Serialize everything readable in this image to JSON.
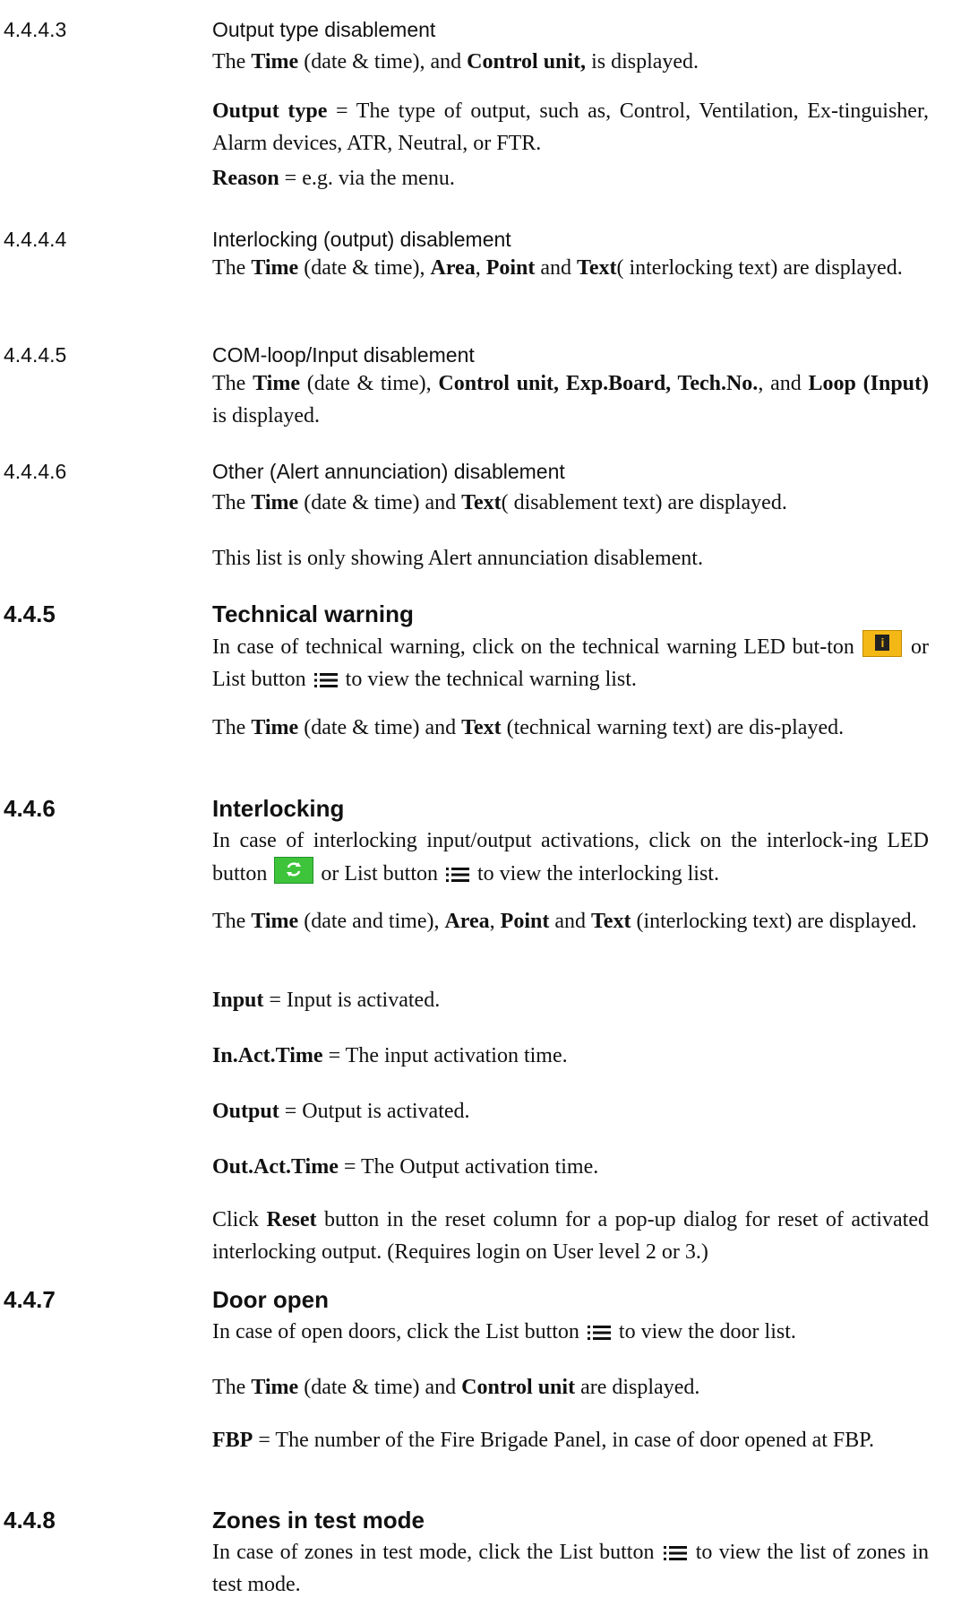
{
  "s4443": {
    "num": "4.4.4.3",
    "title": "Output type disablement",
    "p1": {
      "a": "The ",
      "b1": "Time",
      "c": " (date & time), and ",
      "b2": "Control unit,",
      "d": " is displayed."
    },
    "p2": {
      "b1": "Output type",
      "c": " = The type of output, such as, Control, Ventilation, Ex-tinguisher, Alarm devices, ATR, Neutral, or FTR."
    },
    "p3": {
      "b1": "Reason",
      "c": " = e.g. via the menu."
    }
  },
  "s4444": {
    "num": "4.4.4.4",
    "title": "Interlocking (output) disablement",
    "p1": {
      "a": "The ",
      "b1": "Time",
      "c": " (date & time), ",
      "b2": "Area",
      "d": ", ",
      "b3": "Point",
      "e": " and ",
      "b4": "Text",
      "f": "( interlocking text) are displayed."
    }
  },
  "s4445": {
    "num": "4.4.4.5",
    "title": "COM-loop/Input disablement",
    "p1": {
      "a": "The ",
      "b1": "Time",
      "c": " (date & time), ",
      "b2": "Control unit, Exp.Board, Tech.No.",
      "d": ", and ",
      "b3": "Loop (Input)",
      "e": " is displayed."
    }
  },
  "s4446": {
    "num": "4.4.4.6",
    "title": "Other (Alert annunciation) disablement",
    "p1": {
      "a": "The ",
      "b1": "Time",
      "c": " (date & time) and ",
      "b2": "Text",
      "d": "( disablement text) are displayed."
    },
    "p2": "This list is only showing Alert annunciation disablement."
  },
  "s445": {
    "num": "4.4.5",
    "title": "Technical warning",
    "p1": {
      "a": "In case of technical warning, click on the technical warning LED but-ton ",
      "b": " or List button ",
      "c": " to view the technical warning list."
    },
    "p2": {
      "a": "The ",
      "b1": "Time",
      "c": " (date & time) and ",
      "b2": "Text",
      "d": " (technical warning text) are dis-played."
    }
  },
  "s446": {
    "num": "4.4.6",
    "title": "Interlocking",
    "p1": {
      "a": "In case of interlocking input/output activations, click on the interlock-ing LED button ",
      "b": " or List button ",
      "c": " to view the interlocking list."
    },
    "p2": {
      "a": "The ",
      "b1": "Time",
      "c": " (date and time), ",
      "b2": "Area",
      "d": ", ",
      "b3": "Point",
      "e": " and ",
      "b4": "Text",
      "f": " (interlocking text) are displayed."
    },
    "p3": {
      "b": "Input",
      "c": " = Input is activated."
    },
    "p4": {
      "b": "In.Act.Time",
      "c": " = The input activation time."
    },
    "p5": {
      "b": "Output",
      "c": " = Output is activated."
    },
    "p6": {
      "b": "Out.Act.Time",
      "c": " = The Output activation time."
    },
    "p7": {
      "a": "Click ",
      "b": "Reset",
      "c": " button in the reset column for a pop-up dialog for reset of activated interlocking output. (Requires login on User level 2 or 3.)"
    }
  },
  "s447": {
    "num": "4.4.7",
    "title": "Door open",
    "p1": {
      "a": "In case of open doors, click the List button ",
      "b": " to view the door list."
    },
    "p2": {
      "a": "The ",
      "b1": "Time",
      "c": " (date & time) and ",
      "b2": "Control unit",
      "d": " are displayed."
    },
    "p3": {
      "b": "FBP",
      "c": " = The number of the Fire Brigade Panel, in case of door opened at FBP."
    }
  },
  "s448": {
    "num": "4.4.8",
    "title": "Zones in test mode",
    "p1": {
      "a": "In case of zones in test mode, click the List button ",
      "b": " to view the list of zones in test mode."
    }
  },
  "icons": {
    "led_info_letter": "i",
    "led_info_color": "#f4b816",
    "led_interlock_color": "#3ec43a"
  }
}
